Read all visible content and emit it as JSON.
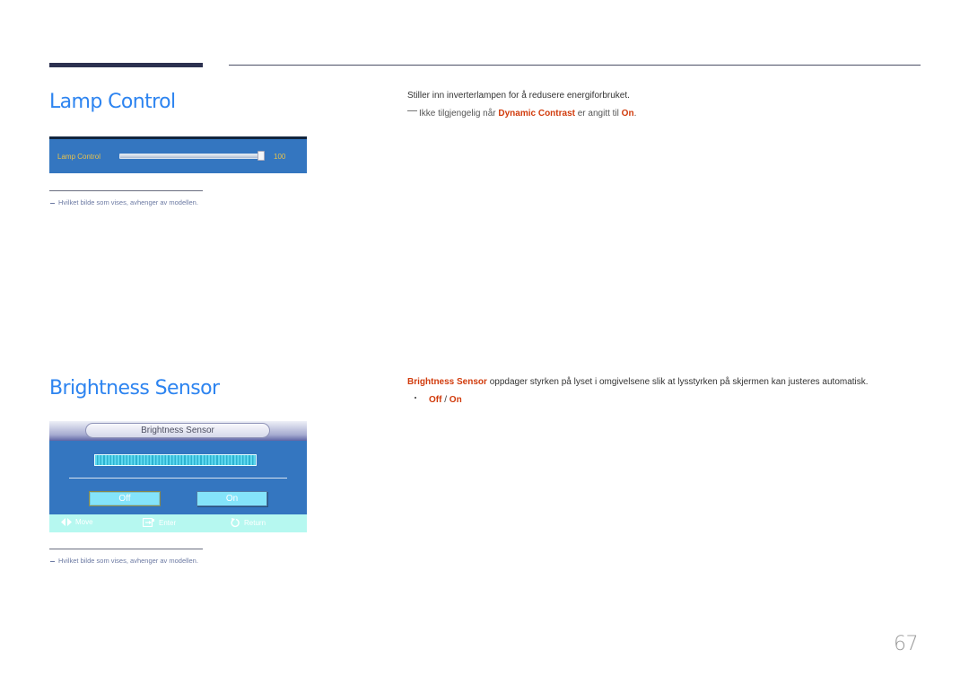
{
  "lamp_control": {
    "title": "Lamp Control",
    "description": "Stiller inn inverterlampen for å redusere energiforbruket.",
    "note": {
      "prefix": "Ikke tilgjengelig når ",
      "highlight1": "Dynamic Contrast",
      "middle": " er angitt til ",
      "highlight2": "On",
      "suffix": "."
    },
    "osd": {
      "label": "Lamp Control",
      "value": "100",
      "slider_fraction": 1.0
    },
    "footnote": "Hvilket bilde som vises, avhenger av modellen."
  },
  "brightness_sensor": {
    "title": "Brightness Sensor",
    "description": {
      "highlight": "Brightness Sensor",
      "text": " oppdager styrken på lyset i omgivelsene slik at lysstyrken på skjermen kan justeres automatisk."
    },
    "options": {
      "off": "Off",
      "separator": " / ",
      "on": "On"
    },
    "osd": {
      "header": "Brightness Sensor",
      "off_button": "Off",
      "on_button": "On",
      "selected": "Off",
      "footer": {
        "move": "Move",
        "enter": "Enter",
        "return": "Return"
      }
    },
    "footnote": "Hvilket bilde som vises, avhenger av modellen."
  },
  "page_number": "67",
  "colors": {
    "heading": "#2d84f0",
    "highlight": "#d13b0c",
    "osd_blue": "#3476c0",
    "osd_label": "#e8c24c"
  }
}
